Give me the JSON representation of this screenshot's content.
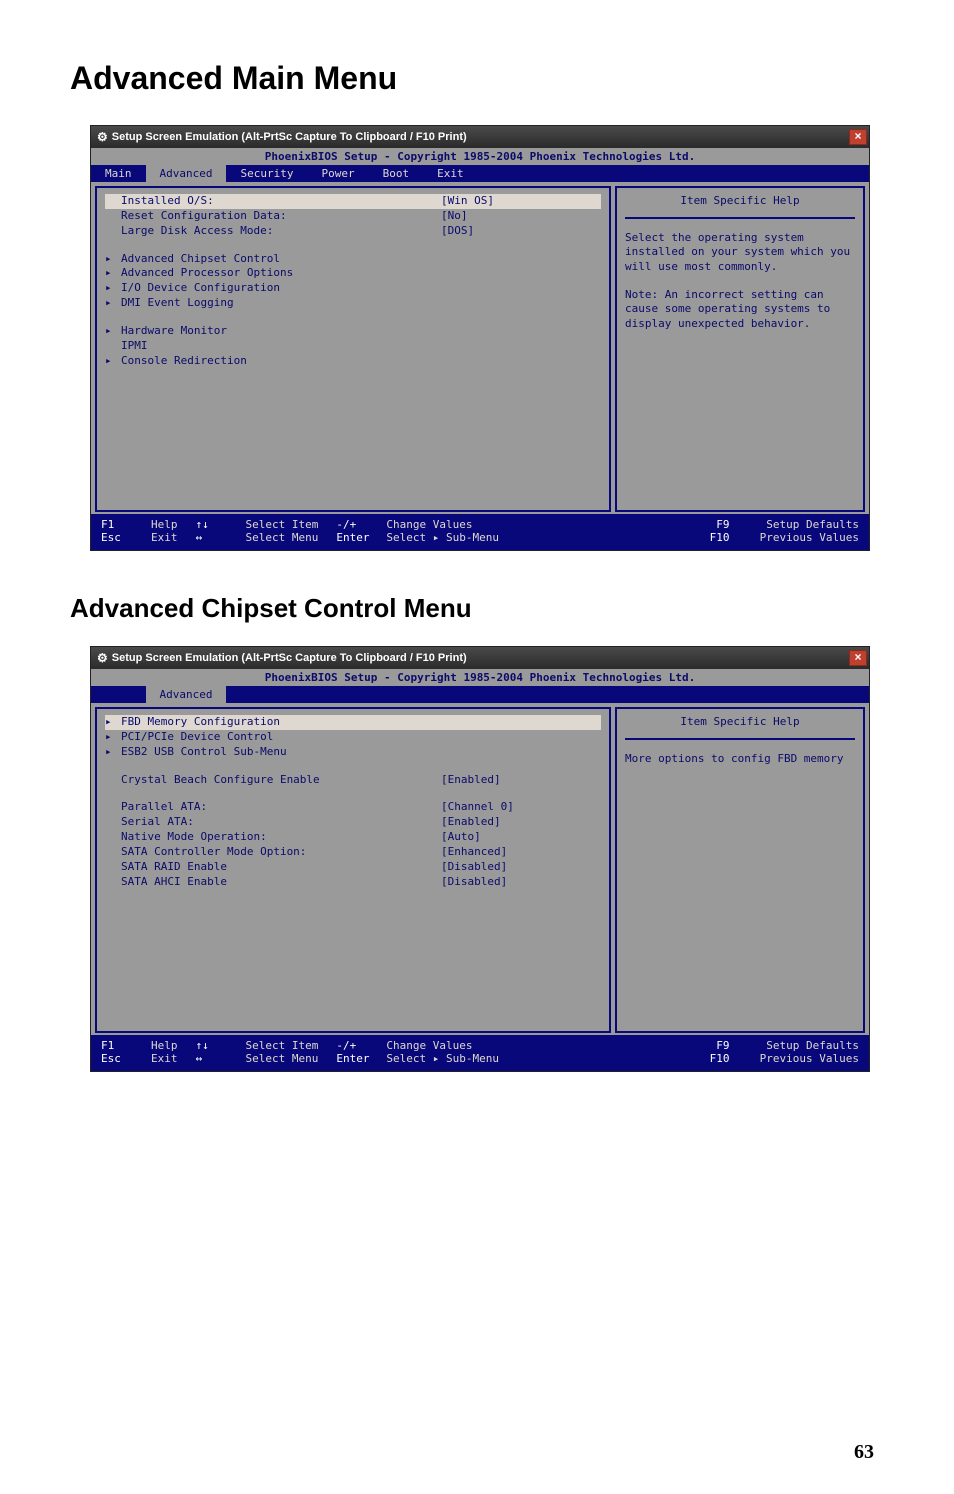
{
  "headings": {
    "main": "Advanced Main Menu",
    "sub": "Advanced Chipset Control Menu"
  },
  "page_number": "63",
  "common": {
    "titlebar_gear": "⚙",
    "titlebar_close": "×",
    "titlebar_text": "Setup Screen Emulation (Alt-PrtSc Capture To Clipboard / F10 Print)",
    "copyright": "PhoenixBIOS Setup - Copyright 1985-2004 Phoenix Technologies Ltd.",
    "tabs": [
      "Main",
      "Advanced",
      "Security",
      "Power",
      "Boot",
      "Exit"
    ],
    "help_title": "Item Specific Help",
    "footer": {
      "f1": "F1",
      "help": "Help",
      "esc": "Esc",
      "exit": "Exit",
      "updown": "↑↓",
      "select_item": "Select Item",
      "leftright": "↔",
      "select_menu": "Select Menu",
      "minusplus": "-/+",
      "change_values": "Change Values",
      "enter": "Enter",
      "select_sub": "Select ▸ Sub-Menu",
      "f9": "F9",
      "setup_defaults": "Setup Defaults",
      "f10": "F10",
      "previous_values": "Previous Values"
    }
  },
  "screen1": {
    "active_tab": 1,
    "rows": [
      {
        "arrow": "",
        "label": "Installed O/S:",
        "value": "[Win OS]",
        "selected": true
      },
      {
        "arrow": "",
        "label": "Reset Configuration Data:",
        "value": "[No]"
      },
      {
        "arrow": "",
        "label": "Large Disk Access Mode:",
        "value": "[DOS]"
      },
      {
        "blank": true
      },
      {
        "arrow": "▸",
        "label": "Advanced Chipset Control"
      },
      {
        "arrow": "▸",
        "label": "Advanced Processor Options"
      },
      {
        "arrow": "▸",
        "label": "I/O Device Configuration"
      },
      {
        "arrow": "▸",
        "label": "DMI Event Logging"
      },
      {
        "blank": true
      },
      {
        "arrow": "▸",
        "label": "Hardware Monitor"
      },
      {
        "arrow": "",
        "label": "IPMI"
      },
      {
        "arrow": "▸",
        "label": "Console Redirection"
      }
    ],
    "help_text": "Select the operating system installed on your system which you will use most commonly.\n\nNote: An incorrect setting can cause some operating systems to display unexpected behavior."
  },
  "screen2": {
    "active_tab": 1,
    "show_only_active_tab": true,
    "rows": [
      {
        "arrow": "▸",
        "label": "FBD Memory Configuration",
        "selected": true
      },
      {
        "arrow": "▸",
        "label": "PCI/PCIe Device Control"
      },
      {
        "arrow": "▸",
        "label": "ESB2 USB Control Sub-Menu"
      },
      {
        "blank": true
      },
      {
        "arrow": "",
        "label": "Crystal Beach Configure Enable",
        "value": "[Enabled]"
      },
      {
        "blank": true
      },
      {
        "arrow": "",
        "label": "Parallel ATA:",
        "value": "[Channel 0]"
      },
      {
        "arrow": "",
        "label": "Serial ATA:",
        "value": "[Enabled]"
      },
      {
        "arrow": "",
        "label": "Native Mode Operation:",
        "value": "[Auto]"
      },
      {
        "arrow": "",
        "label": "SATA Controller Mode Option:",
        "value": "[Enhanced]"
      },
      {
        "arrow": "",
        "label": "SATA RAID Enable",
        "value": "[Disabled]"
      },
      {
        "arrow": "",
        "label": "SATA AHCI Enable",
        "value": "[Disabled]"
      }
    ],
    "help_text": "More options to config FBD memory"
  }
}
